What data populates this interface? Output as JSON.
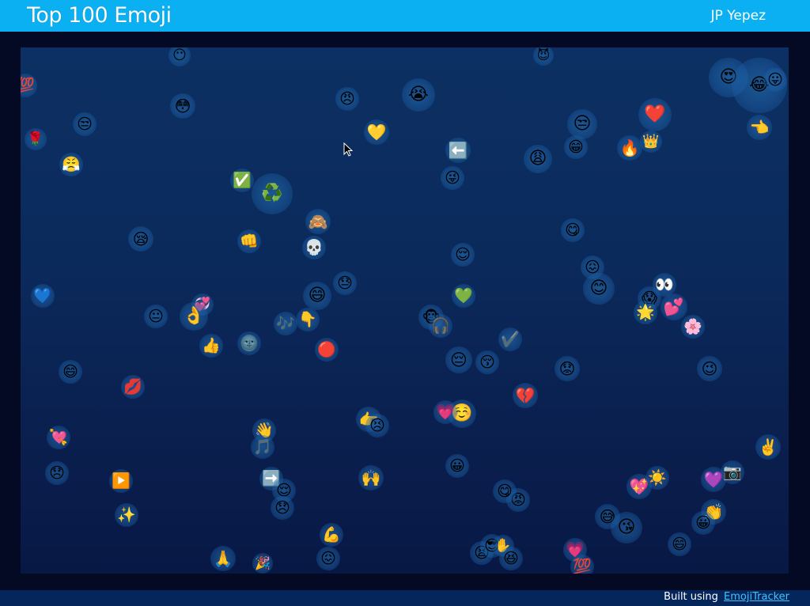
{
  "header": {
    "title": "Top 100 Emoji",
    "author": "JP Yepez"
  },
  "footer": {
    "built_prefix": "Built using",
    "link_label": "EmojiTracker"
  },
  "emoji": [
    {
      "name": "hundred-points",
      "glyph": "💯"
    },
    {
      "name": "grinning-face",
      "glyph": "😶"
    },
    {
      "name": "flushed-face",
      "glyph": "😳"
    },
    {
      "name": "smiling-imp",
      "glyph": "😈"
    },
    {
      "name": "loudly-crying-face",
      "glyph": "😭"
    },
    {
      "name": "angry-face",
      "glyph": "😠"
    },
    {
      "name": "yellow-heart",
      "glyph": "💛"
    },
    {
      "name": "unamused-face",
      "glyph": "😒"
    },
    {
      "name": "heart-eyes",
      "glyph": "😍"
    },
    {
      "name": "tears-of-joy",
      "glyph": "😂"
    },
    {
      "name": "tongue-out",
      "glyph": "😛"
    },
    {
      "name": "rose",
      "glyph": "🌹"
    },
    {
      "name": "persevering-face",
      "glyph": "😣"
    },
    {
      "name": "steam-face",
      "glyph": "😤"
    },
    {
      "name": "red-heart",
      "glyph": "❤️"
    },
    {
      "name": "fire",
      "glyph": "🔥"
    },
    {
      "name": "crown",
      "glyph": "👑"
    },
    {
      "name": "hand-pointing-left",
      "glyph": "👈"
    },
    {
      "name": "check-mark-button",
      "glyph": "✅"
    },
    {
      "name": "recycling-symbol",
      "glyph": "♻️"
    },
    {
      "name": "back-arrow-button",
      "glyph": "⬅️"
    },
    {
      "name": "tongue-wink",
      "glyph": "😜"
    },
    {
      "name": "weary-face",
      "glyph": "😩"
    },
    {
      "name": "grimacing-face",
      "glyph": "😁"
    },
    {
      "name": "see-no-evil-monkey",
      "glyph": "🙈"
    },
    {
      "name": "oncoming-fist",
      "glyph": "👊"
    },
    {
      "name": "skull",
      "glyph": "💀"
    },
    {
      "name": "sleepy-face",
      "glyph": "😪"
    },
    {
      "name": "savoring-face",
      "glyph": "😋"
    },
    {
      "name": "relieved-face",
      "glyph": "😌"
    },
    {
      "name": "blue-heart",
      "glyph": "💙"
    },
    {
      "name": "beaming-face",
      "glyph": "😄"
    },
    {
      "name": "downcast-sweat",
      "glyph": "😓"
    },
    {
      "name": "confounded-face",
      "glyph": "😖"
    },
    {
      "name": "smiling-face",
      "glyph": "😊"
    },
    {
      "name": "eyes",
      "glyph": "👀"
    },
    {
      "name": "screaming-face",
      "glyph": "😱"
    },
    {
      "name": "revolving-hearts",
      "glyph": "💕"
    },
    {
      "name": "star",
      "glyph": "🌟"
    },
    {
      "name": "cherry-blossom",
      "glyph": "🌸"
    },
    {
      "name": "green-heart",
      "glyph": "💚"
    },
    {
      "name": "neutral-face",
      "glyph": "😐"
    },
    {
      "name": "two-hearts",
      "glyph": "💞"
    },
    {
      "name": "ok-hand",
      "glyph": "👌"
    },
    {
      "name": "musical-notes",
      "glyph": "🎶"
    },
    {
      "name": "point-down",
      "glyph": "👇"
    },
    {
      "name": "monkey-face",
      "glyph": "🐵"
    },
    {
      "name": "headphones",
      "glyph": "🎧"
    },
    {
      "name": "check-mark",
      "glyph": "✔️"
    },
    {
      "name": "thumbs-up",
      "glyph": "👍"
    },
    {
      "name": "new-moon-face",
      "glyph": "🌚"
    },
    {
      "name": "red-circle",
      "glyph": "🔴"
    },
    {
      "name": "pensive-face",
      "glyph": "😔"
    },
    {
      "name": "kissing-closed-eyes",
      "glyph": "😚"
    },
    {
      "name": "worried-face",
      "glyph": "😟"
    },
    {
      "name": "wink-face",
      "glyph": "😉"
    },
    {
      "name": "broken-heart",
      "glyph": "💔"
    },
    {
      "name": "kiss-mark",
      "glyph": "💋"
    },
    {
      "name": "point-right",
      "glyph": "👉"
    },
    {
      "name": "relaxed-face",
      "glyph": "☺️"
    },
    {
      "name": "pink-heart",
      "glyph": "💗"
    },
    {
      "name": "heart-with-arrow",
      "glyph": "💘"
    },
    {
      "name": "waving-hand",
      "glyph": "👋"
    },
    {
      "name": "musical-note",
      "glyph": "🎵"
    },
    {
      "name": "victory-hand",
      "glyph": "✌️"
    },
    {
      "name": "disappointed-face",
      "glyph": "😞"
    },
    {
      "name": "play-button",
      "glyph": "▶️"
    },
    {
      "name": "right-arrow",
      "glyph": "➡️"
    },
    {
      "name": "raising-hands",
      "glyph": "🙌"
    },
    {
      "name": "smiley-face",
      "glyph": "😀"
    },
    {
      "name": "purple-heart",
      "glyph": "💜"
    },
    {
      "name": "camera",
      "glyph": "📷"
    },
    {
      "name": "sparkling-heart",
      "glyph": "💖"
    },
    {
      "name": "sun",
      "glyph": "☀️"
    },
    {
      "name": "pouting-face",
      "glyph": "😡"
    },
    {
      "name": "sparkles",
      "glyph": "✨"
    },
    {
      "name": "clapping-hands",
      "glyph": "👏"
    },
    {
      "name": "sweat-smile",
      "glyph": "😅"
    },
    {
      "name": "kissing-heart",
      "glyph": "😘"
    },
    {
      "name": "flexed-biceps",
      "glyph": "💪"
    },
    {
      "name": "folded-hands",
      "glyph": "🙏"
    },
    {
      "name": "party-popper",
      "glyph": "🎉"
    },
    {
      "name": "tired-face",
      "glyph": "😫"
    },
    {
      "name": "sunglasses-face",
      "glyph": "😎"
    },
    {
      "name": "raised-hand",
      "glyph": "✋"
    },
    {
      "name": "laughing-face",
      "glyph": "😆"
    }
  ]
}
